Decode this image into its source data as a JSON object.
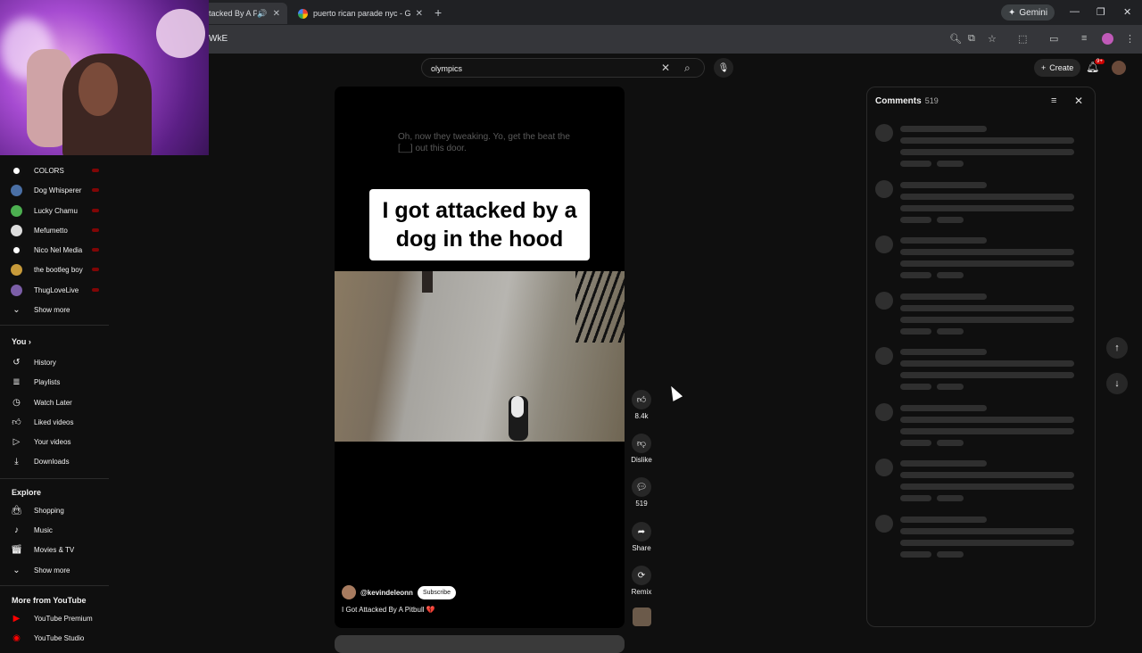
{
  "browser": {
    "tabs": [
      {
        "title": "tacked By A Pi",
        "active": true
      },
      {
        "title": "puerto rican parade nyc - Goog",
        "active": false
      }
    ],
    "address_fragment": "WkE",
    "gemini_label": "Gemini"
  },
  "header": {
    "search_value": "olympics",
    "create_label": "Create",
    "notif_badge": "9+"
  },
  "sidebar": {
    "subscriptions": [
      {
        "label": "COLORS",
        "avatar_color": "#ffffff"
      },
      {
        "label": "Dog Whisperer",
        "avatar_color": "#4a6fa5"
      },
      {
        "label": "Lucky Chamu",
        "avatar_color": "#4caf50"
      },
      {
        "label": "Mefumetto",
        "avatar_color": "#dddddd"
      },
      {
        "label": "Nico Nel Media",
        "avatar_color": "#ffffff"
      },
      {
        "label": "the bootleg boy",
        "avatar_color": "#c79a3a"
      },
      {
        "label": "ThugLoveLive",
        "avatar_color": "#7b5ea7"
      }
    ],
    "show_more_1": "Show more",
    "you_heading": "You",
    "you_items": [
      {
        "label": "History",
        "icon": "history-icon"
      },
      {
        "label": "Playlists",
        "icon": "playlists-icon"
      },
      {
        "label": "Watch Later",
        "icon": "clock-icon"
      },
      {
        "label": "Liked videos",
        "icon": "thumb-up-icon"
      },
      {
        "label": "Your videos",
        "icon": "play-icon"
      },
      {
        "label": "Downloads",
        "icon": "download-icon"
      }
    ],
    "explore_heading": "Explore",
    "explore_items": [
      {
        "label": "Shopping",
        "icon": "shopping-bag-icon"
      },
      {
        "label": "Music",
        "icon": "music-note-icon"
      },
      {
        "label": "Movies & TV",
        "icon": "clapperboard-icon"
      }
    ],
    "show_more_2": "Show more",
    "more_heading": "More from YouTube",
    "more_items": [
      {
        "label": "YouTube Premium"
      },
      {
        "label": "YouTube Studio"
      }
    ]
  },
  "video": {
    "ghost_caption": "Oh, now they tweaking. Yo, get the beat the [__] out this door.",
    "title_card": "I got attacked by a dog in the hood",
    "channel": "@kevindeleonn",
    "subscribe_label": "Subscribe",
    "title": "I Got Attacked By A Pitbull 💔"
  },
  "actions": {
    "likes": "8.4k",
    "dislike_label": "Dislike",
    "comments_count": "519",
    "share_label": "Share",
    "remix_label": "Remix"
  },
  "comments": {
    "title": "Comments",
    "count": "519",
    "loading_placeholders": 8
  }
}
